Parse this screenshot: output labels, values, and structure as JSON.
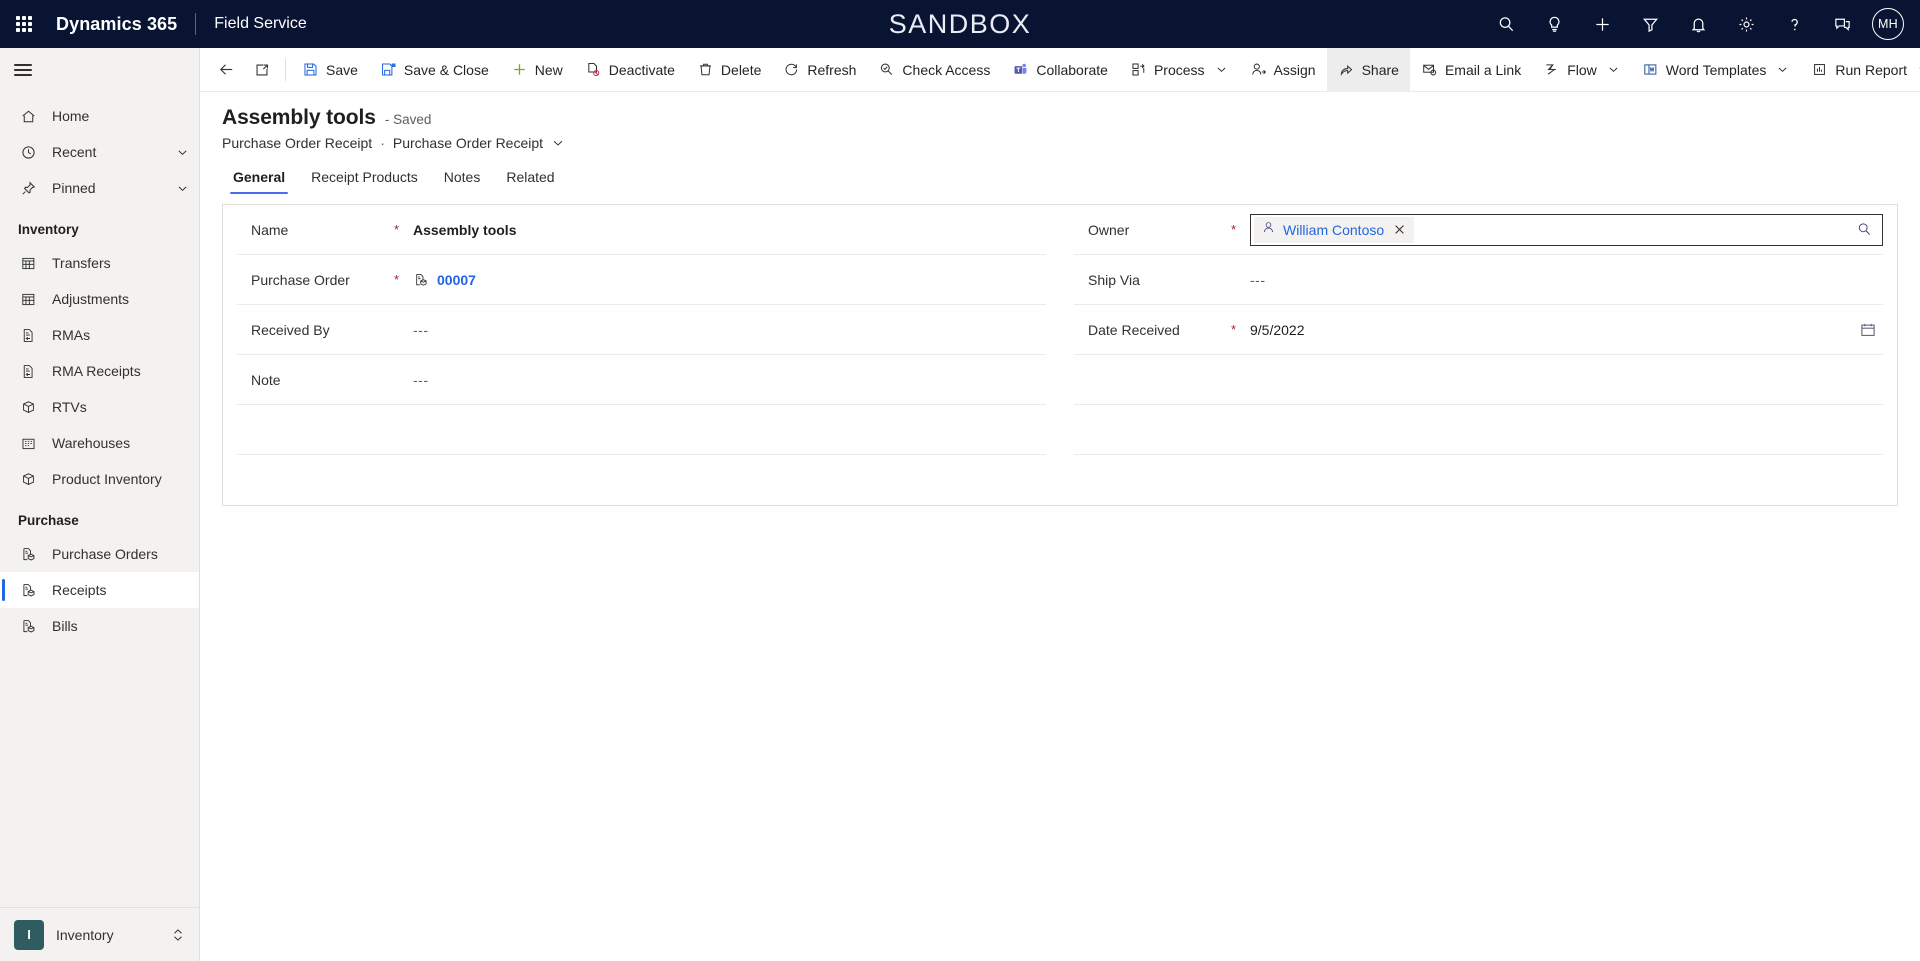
{
  "header": {
    "waffle_icon": "app-launcher-icon",
    "brand": "Dynamics 365",
    "app_name": "Field Service",
    "env_banner": "SANDBOX",
    "actions": [
      {
        "name": "search-icon",
        "label": "Search"
      },
      {
        "name": "lightbulb-icon",
        "label": "Insights"
      },
      {
        "name": "plus-icon",
        "label": "Quick Create"
      },
      {
        "name": "filter-icon",
        "label": "Filter"
      },
      {
        "name": "bell-icon",
        "label": "Notifications"
      },
      {
        "name": "gear-icon",
        "label": "Settings"
      },
      {
        "name": "question-icon",
        "label": "Help"
      },
      {
        "name": "feedback-icon",
        "label": "Feedback"
      }
    ],
    "avatar_initials": "MH"
  },
  "sidebar": {
    "hamburger_label": "Expand navigation",
    "items": [
      {
        "label": "Home",
        "icon": "home-icon",
        "chevron": false,
        "selected": false
      },
      {
        "label": "Recent",
        "icon": "clock-icon",
        "chevron": true,
        "selected": false
      },
      {
        "label": "Pinned",
        "icon": "pin-icon",
        "chevron": true,
        "selected": false
      }
    ],
    "groups": [
      {
        "title": "Inventory",
        "items": [
          {
            "label": "Transfers",
            "icon": "transfer-icon",
            "selected": false
          },
          {
            "label": "Adjustments",
            "icon": "adjustment-icon",
            "selected": false
          },
          {
            "label": "RMAs",
            "icon": "document-return-icon",
            "selected": false
          },
          {
            "label": "RMA Receipts",
            "icon": "document-return-icon",
            "selected": false
          },
          {
            "label": "RTVs",
            "icon": "box-return-icon",
            "selected": false
          },
          {
            "label": "Warehouses",
            "icon": "warehouse-icon",
            "selected": false
          },
          {
            "label": "Product Inventory",
            "icon": "box-icon",
            "selected": false
          }
        ]
      },
      {
        "title": "Purchase",
        "items": [
          {
            "label": "Purchase Orders",
            "icon": "purchase-doc-icon",
            "selected": false
          },
          {
            "label": "Receipts",
            "icon": "purchase-doc-icon",
            "selected": true
          },
          {
            "label": "Bills",
            "icon": "purchase-doc-icon",
            "selected": false
          }
        ]
      }
    ],
    "area_switcher": {
      "tile_letter": "I",
      "label": "Inventory"
    }
  },
  "commandbar": {
    "back_icon": "back-arrow-icon",
    "popout_icon": "open-in-new-window-icon",
    "commands": [
      {
        "label": "Save",
        "icon": "save-icon",
        "chevron": false,
        "active": false
      },
      {
        "label": "Save & Close",
        "icon": "save-close-icon",
        "chevron": false,
        "active": false
      },
      {
        "label": "New",
        "icon": "plus-icon",
        "chevron": false,
        "active": false
      },
      {
        "label": "Deactivate",
        "icon": "deactivate-icon",
        "chevron": false,
        "active": false
      },
      {
        "label": "Delete",
        "icon": "trash-icon",
        "chevron": false,
        "active": false
      },
      {
        "label": "Refresh",
        "icon": "refresh-icon",
        "chevron": false,
        "active": false
      },
      {
        "label": "Check Access",
        "icon": "check-access-icon",
        "chevron": false,
        "active": false
      },
      {
        "label": "Collaborate",
        "icon": "teams-icon",
        "chevron": false,
        "active": false
      },
      {
        "label": "Process",
        "icon": "process-icon",
        "chevron": true,
        "active": false
      },
      {
        "label": "Assign",
        "icon": "assign-user-icon",
        "chevron": false,
        "active": false
      },
      {
        "label": "Share",
        "icon": "share-icon",
        "chevron": false,
        "active": true
      },
      {
        "label": "Email a Link",
        "icon": "email-link-icon",
        "chevron": false,
        "active": false
      },
      {
        "label": "Flow",
        "icon": "flow-icon",
        "chevron": true,
        "active": false
      },
      {
        "label": "Word Templates",
        "icon": "word-icon",
        "chevron": true,
        "active": false
      },
      {
        "label": "Run Report",
        "icon": "report-icon",
        "chevron": true,
        "active": false
      }
    ]
  },
  "page": {
    "title": "Assembly tools",
    "status": "- Saved",
    "breadcrumb_parent": "Purchase Order Receipt",
    "breadcrumb_separator": "·",
    "breadcrumb_current": "Purchase Order Receipt",
    "tabs": [
      {
        "label": "General",
        "active": true
      },
      {
        "label": "Receipt Products",
        "active": false
      },
      {
        "label": "Notes",
        "active": false
      },
      {
        "label": "Related",
        "active": false
      }
    ]
  },
  "form": {
    "required_marker": "*",
    "empty_value": "---",
    "left": [
      {
        "label": "Name",
        "required": true,
        "value": "Assembly tools",
        "type": "text-bold"
      },
      {
        "label": "Purchase Order",
        "required": true,
        "value": "00007",
        "type": "record-link",
        "icon": "purchase-doc-icon"
      },
      {
        "label": "Received By",
        "required": false,
        "value": "---",
        "type": "empty"
      },
      {
        "label": "Note",
        "required": false,
        "value": "---",
        "type": "empty"
      }
    ],
    "right": [
      {
        "label": "Owner",
        "required": true,
        "value": "William Contoso",
        "type": "lookup",
        "chip_icon": "person-icon",
        "clear_icon": "close-icon",
        "search_icon": "search-icon"
      },
      {
        "label": "Ship Via",
        "required": false,
        "value": "---",
        "type": "empty"
      },
      {
        "label": "Date Received",
        "required": true,
        "value": "9/5/2022",
        "type": "date",
        "icon": "calendar-icon"
      }
    ]
  },
  "colors": {
    "header_bg": "#091432",
    "accent_blue": "#2266e3",
    "tab_underline": "#4f6bed",
    "required_red": "#a4262c",
    "sidebar_bg": "#f3f2f1",
    "area_tile": "#2f5c60"
  }
}
